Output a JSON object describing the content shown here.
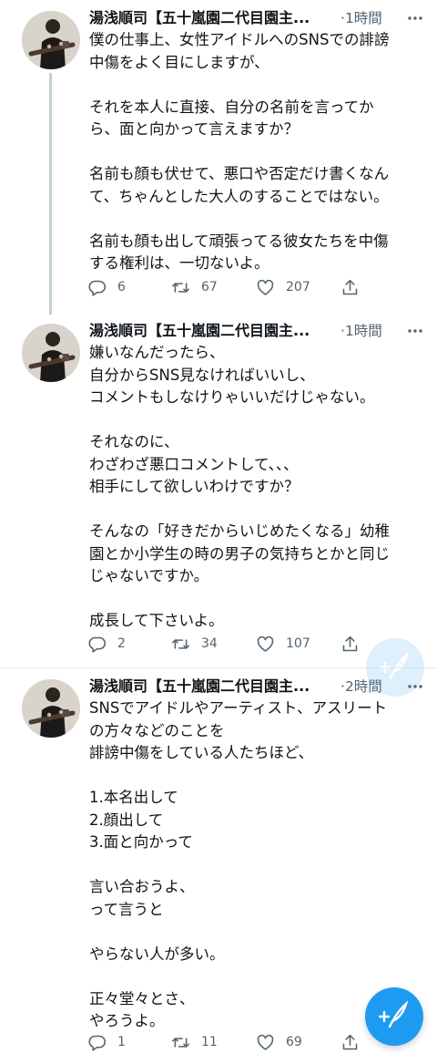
{
  "tweets": [
    {
      "name": "湯浅順司【五十嵐園二代目園主...",
      "time": "1時間",
      "paragraphs": [
        "僕の仕事上、女性アイドルへのSNSでの誹謗\n中傷をよく目にしますが、",
        "それを本人に直接、自分の名前を言ってか\nら、面と向かって言えますか？",
        "名前も顔も伏せて、悪口や否定だけ書くなん\nて、ちゃんとした大人のすることではない。",
        "名前も顔も出して頑張ってる彼女たちを中傷\nする権利は、一切ないよ。"
      ],
      "replies": "6",
      "retweets": "67",
      "likes": "207"
    },
    {
      "name": "湯浅順司【五十嵐園二代目園主...",
      "time": "1時間",
      "paragraphs": [
        "嫌いなんだったら、\n自分からSNS見なければいいし、\nコメントもしなけりゃいいだけじゃない。",
        "それなのに、\nわざわざ悪口コメントして、、、\n相手にして欲しいわけですか？",
        "そんなの「好きだからいじめたくなる」幼稚\n園とか小学生の時の男子の気持ちとかと同じ\nじゃないですか。",
        "成長して下さいよ。"
      ],
      "replies": "2",
      "retweets": "34",
      "likes": "107"
    },
    {
      "name": "湯浅順司【五十嵐園二代目園主...",
      "time": "2時間",
      "paragraphs": [
        "SNSでアイドルやアーティスト、アスリート\nの方々などのことを\n誹謗中傷をしている人たちほど、",
        "1.本名出して\n2.顔出して\n3.面と向かって",
        "言い合おうよ、\nって言うと",
        "やらない人が多い。",
        "正々堂々とさ、\nやろうよ。"
      ],
      "replies": "1",
      "retweets": "11",
      "likes": "69"
    }
  ],
  "icons": {
    "reply": "reply-icon",
    "retweet": "retweet-icon",
    "like": "heart-icon",
    "share": "share-icon",
    "more": "more-options-icon",
    "compose": "compose-tweet-icon"
  },
  "colors": {
    "accent": "#1d9bf0",
    "text": "#0f1419",
    "secondary": "#536471",
    "divider": "#e6ecf0",
    "thread_line": "#c4cfd6"
  }
}
